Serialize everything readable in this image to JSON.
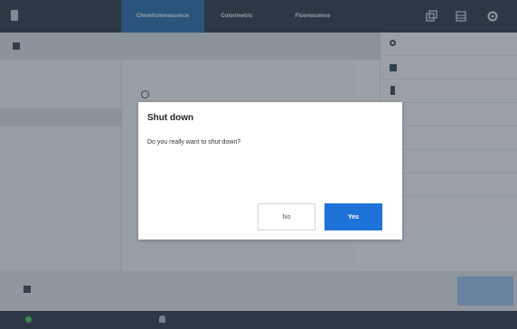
{
  "topbar": {
    "tabs": [
      {
        "label": "Chemiluminescence",
        "active": true
      },
      {
        "label": "Colorimetric",
        "active": false
      },
      {
        "label": "Fluorescence",
        "active": false
      }
    ],
    "icons": [
      "device-icon",
      "copy-icon",
      "grid-icon",
      "gear-icon"
    ]
  },
  "dialog": {
    "title": "Shut down",
    "message": "Do you really want to shut down?",
    "no_label": "No",
    "yes_label": "Yes"
  },
  "colors": {
    "accent": "#1e73d9",
    "topbar": "#1f2e3d",
    "active_tab": "#1d5fa1"
  }
}
